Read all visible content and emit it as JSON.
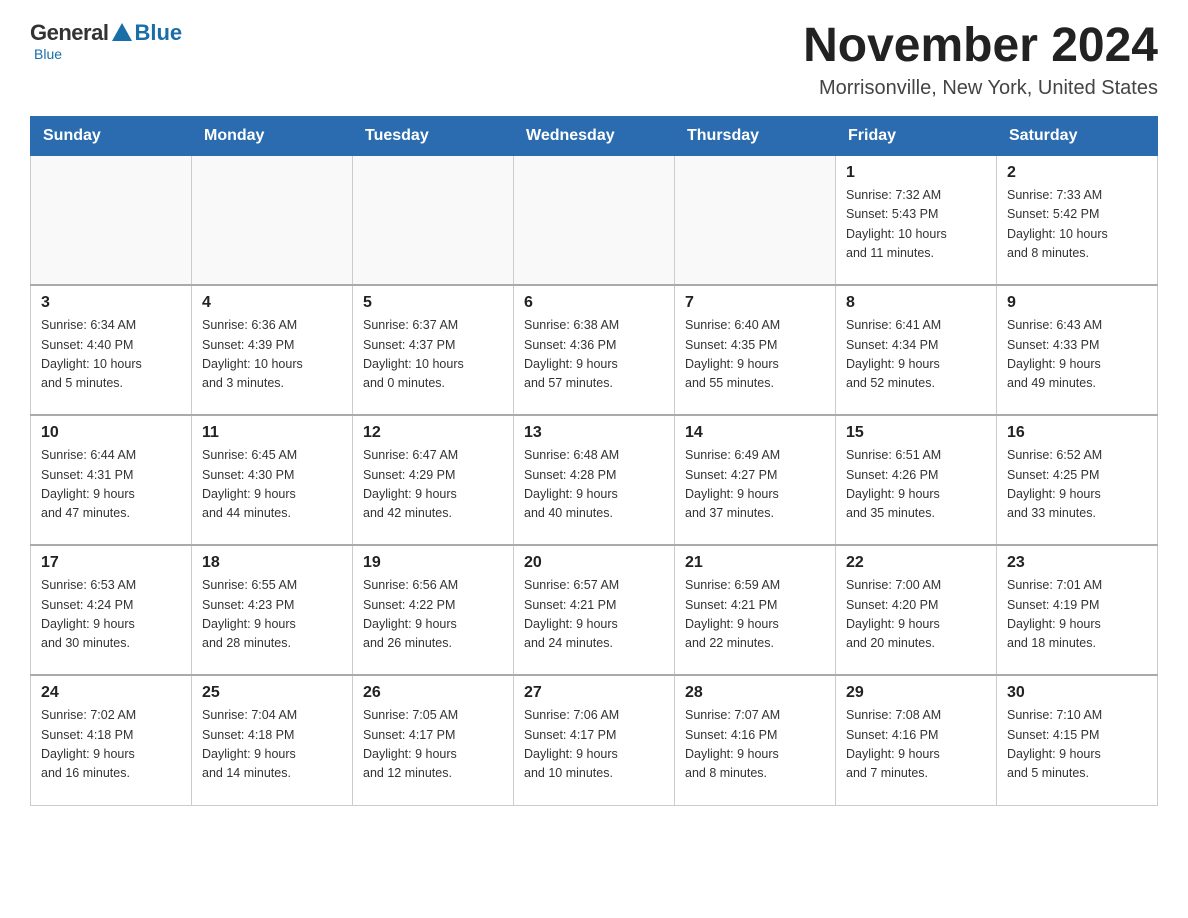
{
  "header": {
    "logo_general": "General",
    "logo_blue": "Blue",
    "main_title": "November 2024",
    "subtitle": "Morrisonville, New York, United States"
  },
  "days_of_week": [
    "Sunday",
    "Monday",
    "Tuesday",
    "Wednesday",
    "Thursday",
    "Friday",
    "Saturday"
  ],
  "weeks": [
    [
      {
        "day": "",
        "info": ""
      },
      {
        "day": "",
        "info": ""
      },
      {
        "day": "",
        "info": ""
      },
      {
        "day": "",
        "info": ""
      },
      {
        "day": "",
        "info": ""
      },
      {
        "day": "1",
        "info": "Sunrise: 7:32 AM\nSunset: 5:43 PM\nDaylight: 10 hours\nand 11 minutes."
      },
      {
        "day": "2",
        "info": "Sunrise: 7:33 AM\nSunset: 5:42 PM\nDaylight: 10 hours\nand 8 minutes."
      }
    ],
    [
      {
        "day": "3",
        "info": "Sunrise: 6:34 AM\nSunset: 4:40 PM\nDaylight: 10 hours\nand 5 minutes."
      },
      {
        "day": "4",
        "info": "Sunrise: 6:36 AM\nSunset: 4:39 PM\nDaylight: 10 hours\nand 3 minutes."
      },
      {
        "day": "5",
        "info": "Sunrise: 6:37 AM\nSunset: 4:37 PM\nDaylight: 10 hours\nand 0 minutes."
      },
      {
        "day": "6",
        "info": "Sunrise: 6:38 AM\nSunset: 4:36 PM\nDaylight: 9 hours\nand 57 minutes."
      },
      {
        "day": "7",
        "info": "Sunrise: 6:40 AM\nSunset: 4:35 PM\nDaylight: 9 hours\nand 55 minutes."
      },
      {
        "day": "8",
        "info": "Sunrise: 6:41 AM\nSunset: 4:34 PM\nDaylight: 9 hours\nand 52 minutes."
      },
      {
        "day": "9",
        "info": "Sunrise: 6:43 AM\nSunset: 4:33 PM\nDaylight: 9 hours\nand 49 minutes."
      }
    ],
    [
      {
        "day": "10",
        "info": "Sunrise: 6:44 AM\nSunset: 4:31 PM\nDaylight: 9 hours\nand 47 minutes."
      },
      {
        "day": "11",
        "info": "Sunrise: 6:45 AM\nSunset: 4:30 PM\nDaylight: 9 hours\nand 44 minutes."
      },
      {
        "day": "12",
        "info": "Sunrise: 6:47 AM\nSunset: 4:29 PM\nDaylight: 9 hours\nand 42 minutes."
      },
      {
        "day": "13",
        "info": "Sunrise: 6:48 AM\nSunset: 4:28 PM\nDaylight: 9 hours\nand 40 minutes."
      },
      {
        "day": "14",
        "info": "Sunrise: 6:49 AM\nSunset: 4:27 PM\nDaylight: 9 hours\nand 37 minutes."
      },
      {
        "day": "15",
        "info": "Sunrise: 6:51 AM\nSunset: 4:26 PM\nDaylight: 9 hours\nand 35 minutes."
      },
      {
        "day": "16",
        "info": "Sunrise: 6:52 AM\nSunset: 4:25 PM\nDaylight: 9 hours\nand 33 minutes."
      }
    ],
    [
      {
        "day": "17",
        "info": "Sunrise: 6:53 AM\nSunset: 4:24 PM\nDaylight: 9 hours\nand 30 minutes."
      },
      {
        "day": "18",
        "info": "Sunrise: 6:55 AM\nSunset: 4:23 PM\nDaylight: 9 hours\nand 28 minutes."
      },
      {
        "day": "19",
        "info": "Sunrise: 6:56 AM\nSunset: 4:22 PM\nDaylight: 9 hours\nand 26 minutes."
      },
      {
        "day": "20",
        "info": "Sunrise: 6:57 AM\nSunset: 4:21 PM\nDaylight: 9 hours\nand 24 minutes."
      },
      {
        "day": "21",
        "info": "Sunrise: 6:59 AM\nSunset: 4:21 PM\nDaylight: 9 hours\nand 22 minutes."
      },
      {
        "day": "22",
        "info": "Sunrise: 7:00 AM\nSunset: 4:20 PM\nDaylight: 9 hours\nand 20 minutes."
      },
      {
        "day": "23",
        "info": "Sunrise: 7:01 AM\nSunset: 4:19 PM\nDaylight: 9 hours\nand 18 minutes."
      }
    ],
    [
      {
        "day": "24",
        "info": "Sunrise: 7:02 AM\nSunset: 4:18 PM\nDaylight: 9 hours\nand 16 minutes."
      },
      {
        "day": "25",
        "info": "Sunrise: 7:04 AM\nSunset: 4:18 PM\nDaylight: 9 hours\nand 14 minutes."
      },
      {
        "day": "26",
        "info": "Sunrise: 7:05 AM\nSunset: 4:17 PM\nDaylight: 9 hours\nand 12 minutes."
      },
      {
        "day": "27",
        "info": "Sunrise: 7:06 AM\nSunset: 4:17 PM\nDaylight: 9 hours\nand 10 minutes."
      },
      {
        "day": "28",
        "info": "Sunrise: 7:07 AM\nSunset: 4:16 PM\nDaylight: 9 hours\nand 8 minutes."
      },
      {
        "day": "29",
        "info": "Sunrise: 7:08 AM\nSunset: 4:16 PM\nDaylight: 9 hours\nand 7 minutes."
      },
      {
        "day": "30",
        "info": "Sunrise: 7:10 AM\nSunset: 4:15 PM\nDaylight: 9 hours\nand 5 minutes."
      }
    ]
  ]
}
